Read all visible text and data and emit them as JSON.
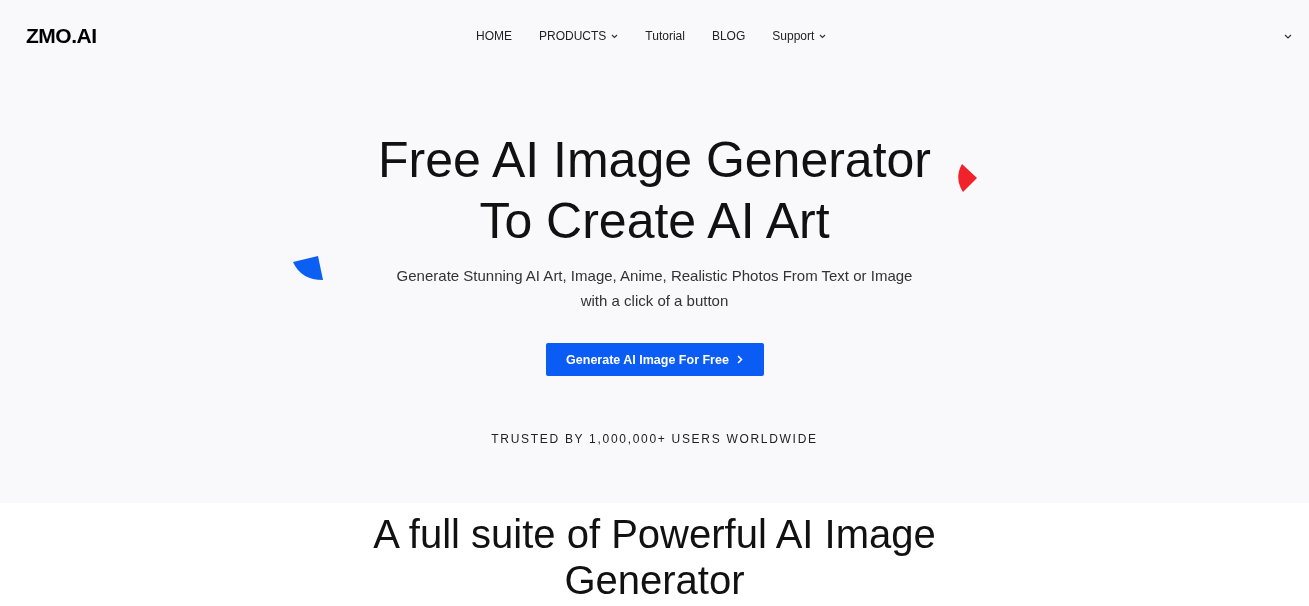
{
  "header": {
    "logo": "ZMO.AI",
    "nav": [
      {
        "label": "HOME",
        "dropdown": false
      },
      {
        "label": "PRODUCTS",
        "dropdown": true
      },
      {
        "label": "Tutorial",
        "dropdown": false
      },
      {
        "label": "BLOG",
        "dropdown": false
      },
      {
        "label": "Support",
        "dropdown": true
      }
    ]
  },
  "hero": {
    "title_lines": [
      "Free AI Image Generator",
      "To Create AI Art"
    ],
    "subtitle_lines": [
      "Generate Stunning AI Art, Image, Anime, Realistic Photos From Text or Image",
      "with a click of a button"
    ],
    "cta": "Generate AI Image For Free",
    "trusted": "TRUSTED BY 1,000,000+ USERS WORLDWIDE"
  },
  "features": {
    "title_lines": [
      "A full suite of Powerful AI Image",
      "Generator"
    ]
  }
}
